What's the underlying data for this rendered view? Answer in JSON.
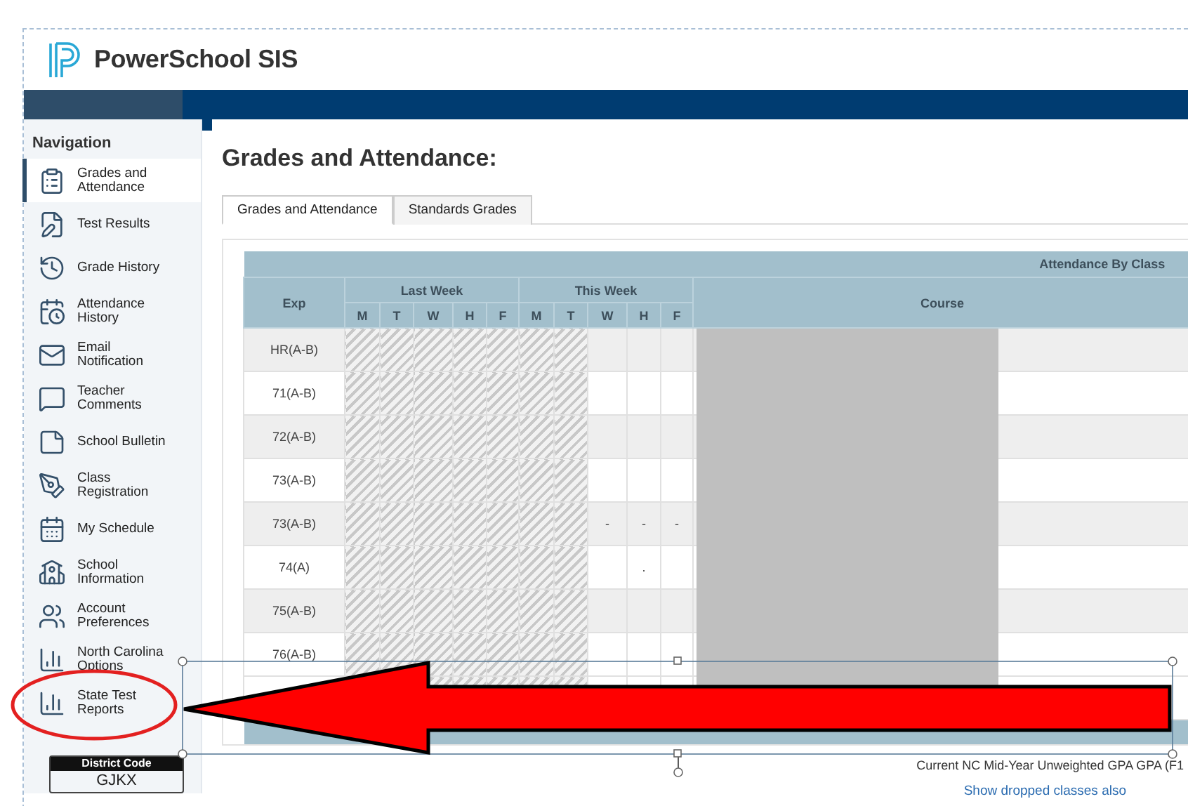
{
  "app": {
    "logo_text": "PowerSchool SIS"
  },
  "navigation": {
    "title": "Navigation",
    "items": [
      {
        "label": "Grades and Attendance",
        "selected": true
      },
      {
        "label": "Test Results",
        "selected": false
      },
      {
        "label": "Grade History",
        "selected": false
      },
      {
        "label": "Attendance History",
        "selected": false
      },
      {
        "label": "Email Notification",
        "selected": false
      },
      {
        "label": "Teacher Comments",
        "selected": false
      },
      {
        "label": "School Bulletin",
        "selected": false
      },
      {
        "label": "Class Registration",
        "selected": false
      },
      {
        "label": "My Schedule",
        "selected": false
      },
      {
        "label": "School Information",
        "selected": false
      },
      {
        "label": "Account Preferences",
        "selected": false
      },
      {
        "label": "North Carolina Options",
        "selected": false
      },
      {
        "label": "State Test Reports",
        "selected": false
      }
    ],
    "district_code": {
      "label": "District Code",
      "value": "GJKX"
    }
  },
  "page": {
    "title": "Grades and Attendance:",
    "tabs": [
      {
        "label": "Grades and Attendance",
        "selected": true
      },
      {
        "label": "Standards Grades",
        "selected": false
      }
    ]
  },
  "table": {
    "group_header": "Attendance By Class",
    "exp_header": "Exp",
    "course_header": "Course",
    "weeks": [
      {
        "label": "Last Week",
        "days": [
          {
            "label": "M",
            "hatched": true
          },
          {
            "label": "T",
            "hatched": true
          },
          {
            "label": "W",
            "hatched": true
          },
          {
            "label": "H",
            "hatched": true
          },
          {
            "label": "F",
            "hatched": true
          }
        ]
      },
      {
        "label": "This Week",
        "days": [
          {
            "label": "M",
            "hatched": true
          },
          {
            "label": "T",
            "hatched": true
          },
          {
            "label": "W",
            "hatched": false
          },
          {
            "label": "H",
            "hatched": false
          },
          {
            "label": "F",
            "hatched": false
          }
        ]
      }
    ],
    "rows": [
      {
        "exp": "HR(A-B)"
      },
      {
        "exp": "71(A-B)"
      },
      {
        "exp": "72(A-B)"
      },
      {
        "exp": "73(A-B)"
      },
      {
        "exp": "73(A-B)",
        "this_week": {
          "wednesday": "-",
          "thursday": "-",
          "friday": "-"
        }
      },
      {
        "exp": "74(A)",
        "this_week": {
          "thursday": "."
        }
      },
      {
        "exp": "75(A-B)"
      },
      {
        "exp": "76(A-B)"
      }
    ]
  },
  "footer": {
    "gpa_text": "Current NC Mid-Year Unweighted GPA GPA (F1",
    "link": "Show dropped classes also"
  }
}
